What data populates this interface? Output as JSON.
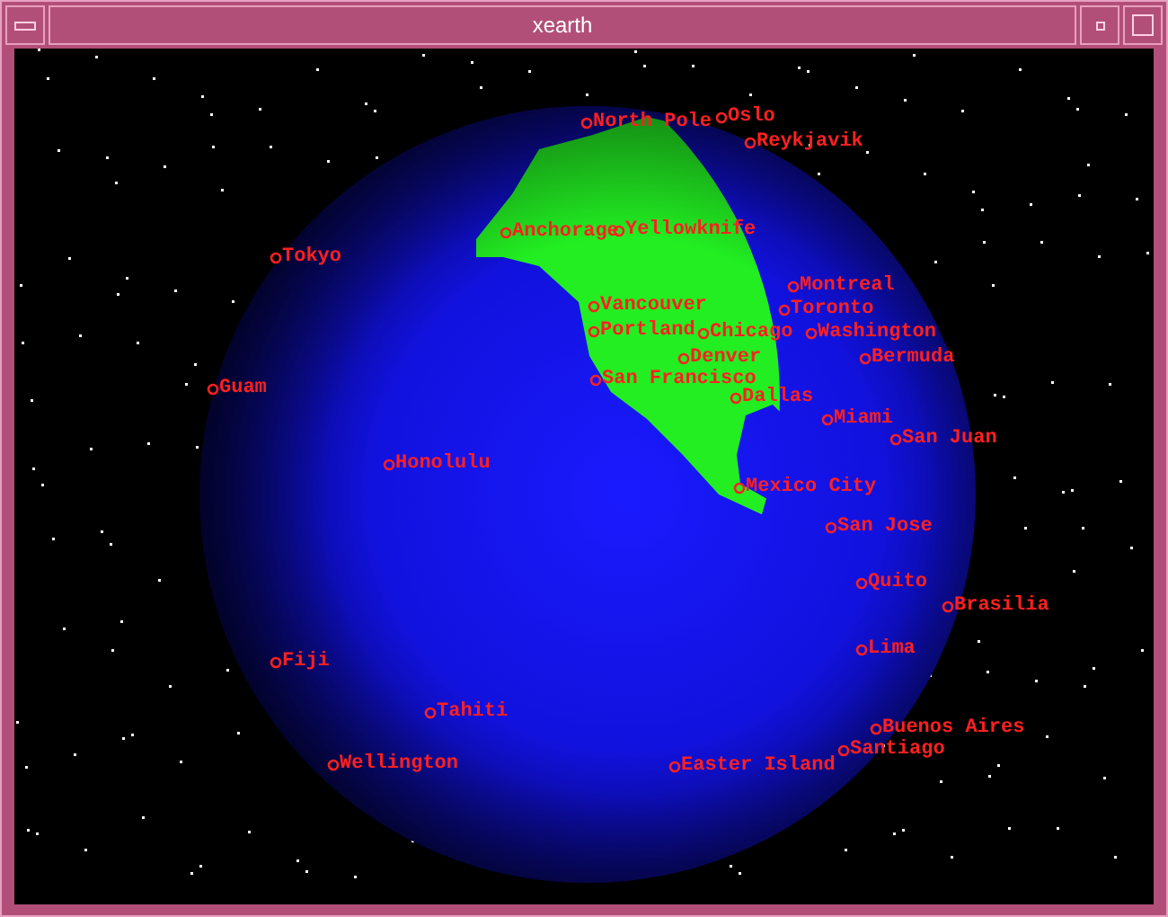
{
  "window": {
    "title": "xearth"
  },
  "cities": [
    "North Pole",
    "Oslo",
    "Reykjavik",
    "Tokyo",
    "Anchorage",
    "Yellowknife",
    "Montreal",
    "Toronto",
    "Vancouver",
    "Portland",
    "Chicago",
    "Washington",
    "Bermuda",
    "Denver",
    "San Francisco",
    "Dallas",
    "Guam",
    "Miami",
    "San Juan",
    "Honolulu",
    "Mexico City",
    "San Jose",
    "Quito",
    "Brasilia",
    "Lima",
    "Fiji",
    "Tahiti",
    "Buenos Aires",
    "Santiago",
    "Wellington",
    "Easter Island"
  ]
}
